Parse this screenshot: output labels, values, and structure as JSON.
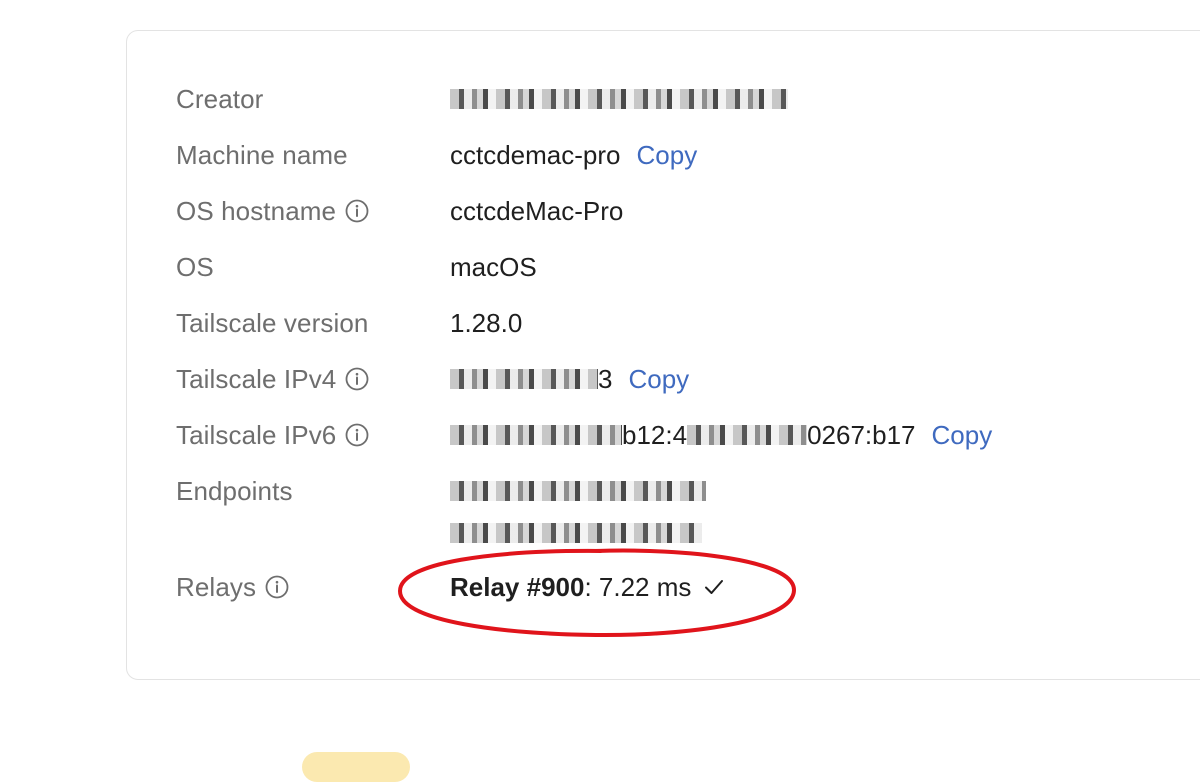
{
  "details": {
    "creator": {
      "label": "Creator",
      "value": "•••087••••••••@gmail.com"
    },
    "machine_name": {
      "label": "Machine name",
      "value": "cctcdemac-pro",
      "copy_label": "Copy"
    },
    "os_hostname": {
      "label": "OS hostname",
      "value": "cctcdeMac-Pro"
    },
    "os": {
      "label": "OS",
      "value": "macOS"
    },
    "tailscale_version": {
      "label": "Tailscale version",
      "value": "1.28.0"
    },
    "tailscale_ipv4": {
      "label": "Tailscale IPv4",
      "value_suffix": "3",
      "copy_label": "Copy"
    },
    "tailscale_ipv6": {
      "label": "Tailscale IPv6",
      "value_mid": "b12:4",
      "value_suffix": "0267:b17",
      "copy_label": "Copy"
    },
    "endpoints": {
      "label": "Endpoints"
    },
    "relays": {
      "label": "Relays",
      "relay_name": "Relay #900",
      "latency": ": 7.22 ms"
    }
  },
  "colors": {
    "label": "#6e6e6e",
    "value": "#1f1f1f",
    "link": "#3f6abf",
    "annotation": "#e0141b",
    "card_border": "#e3e3e3"
  },
  "icons": {
    "info": "info-circle-icon",
    "check": "checkmark-icon"
  }
}
